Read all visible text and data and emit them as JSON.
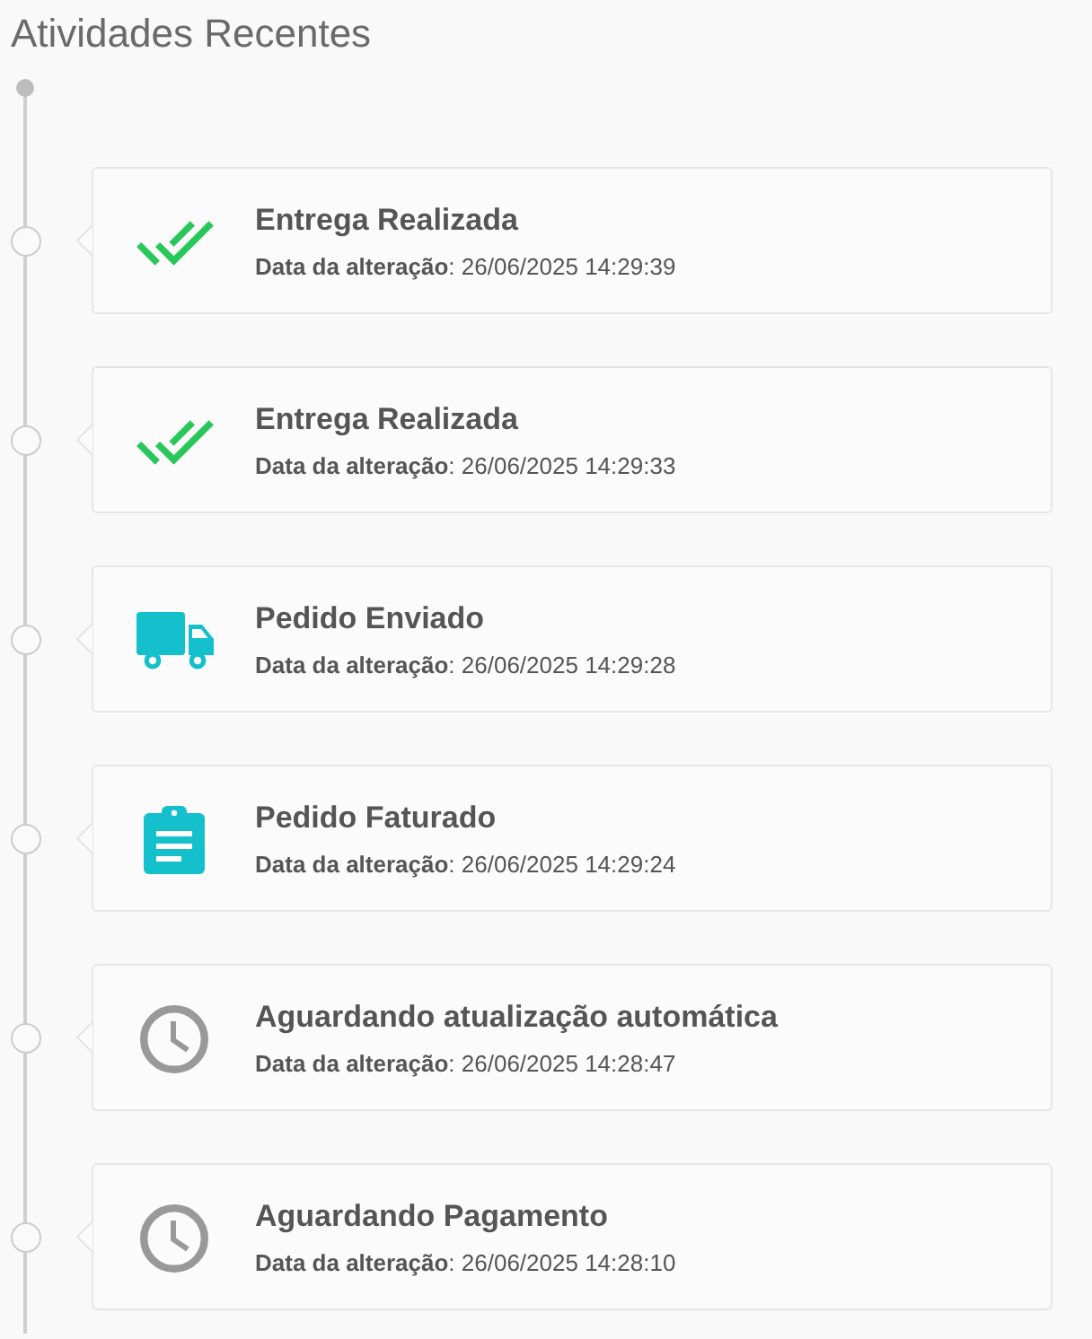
{
  "title": "Atividades Recentes",
  "activities": [
    {
      "kind": "double-check",
      "color": "#27c75a",
      "title": "Entrega Realizada",
      "detail": "**Data da alteração**: 26/06/2025 14:29:39"
    },
    {
      "kind": "double-check",
      "color": "#27c75a",
      "title": "Entrega Realizada",
      "detail": "**Data da alteração**: 26/06/2025 14:29:33"
    },
    {
      "kind": "truck",
      "color": "#14c0cb",
      "title": "Pedido Enviado",
      "detail": "**Data da alteração**: 26/06/2025 14:29:28"
    },
    {
      "kind": "clipboard",
      "color": "#14c0cb",
      "title": "Pedido Faturado",
      "detail": "**Data da alteração**: 26/06/2025 14:29:24"
    },
    {
      "kind": "clock",
      "color": "#999999",
      "title": "Aguardando atualização automática",
      "detail": "**Data da alteração**: 26/06/2025 14:28:47"
    },
    {
      "kind": "clock",
      "color": "#999999",
      "title": "Aguardando Pagamento",
      "detail": "**Data da alteração**: 26/06/2025 14:28:10"
    }
  ]
}
